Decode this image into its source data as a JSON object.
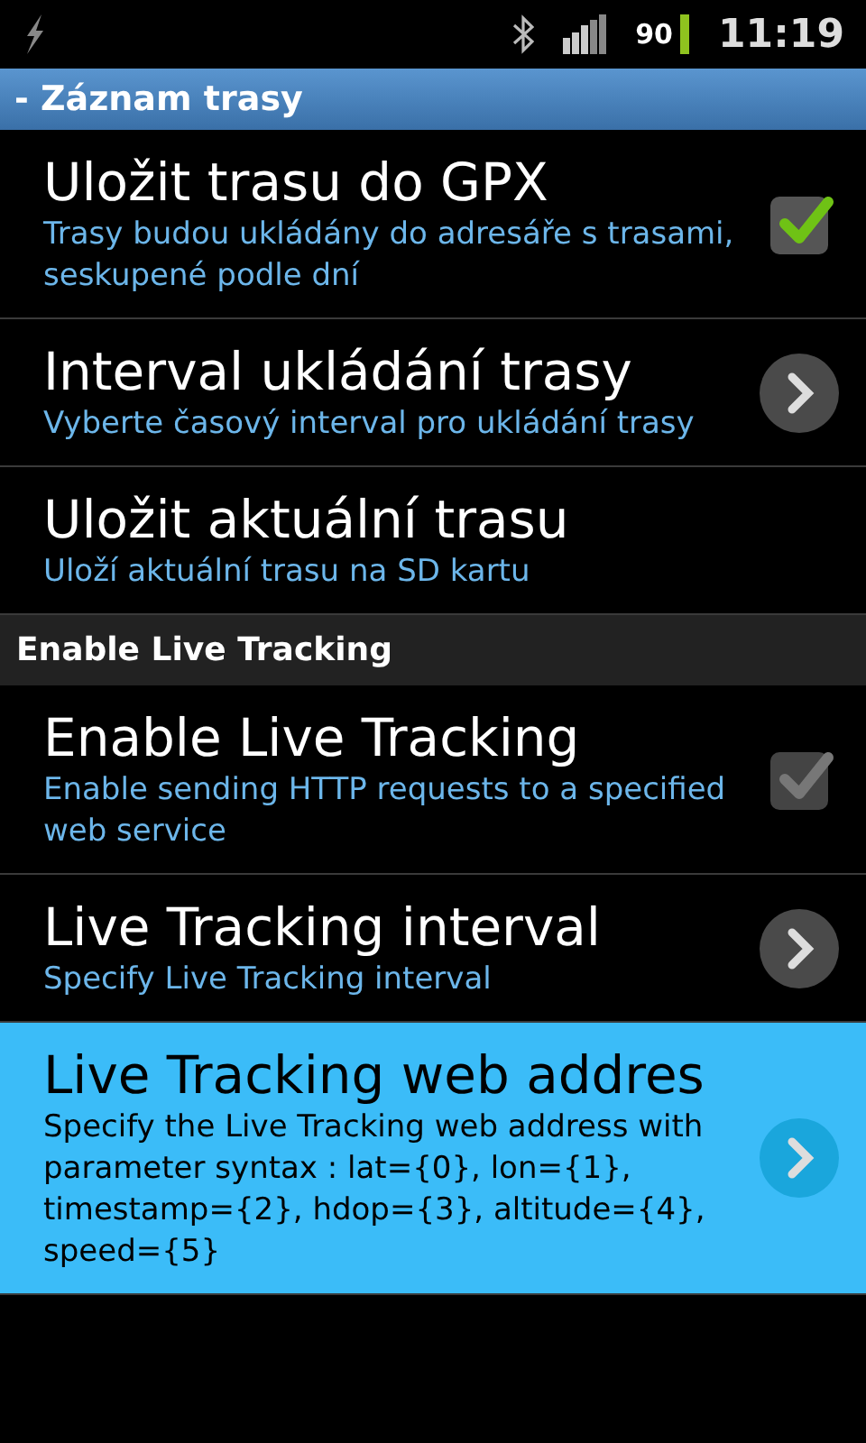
{
  "status_bar": {
    "battery": "90",
    "time": "11:19"
  },
  "title_bar": {
    "title": "- Záznam trasy"
  },
  "items": [
    {
      "kind": "checkbox",
      "title": "Uložit trasu do GPX",
      "summary": "Trasy budou ukládány do adresáře s trasami, seskupené podle dní",
      "checked": true,
      "disabled": false,
      "selected": false
    },
    {
      "kind": "arrow",
      "title": "Interval ukládání trasy",
      "summary": "Vyberte časový interval pro ukládání trasy",
      "selected": false
    },
    {
      "kind": "plain",
      "title": "Uložit aktuální trasu",
      "summary": "Uloží aktuální trasu na SD kartu",
      "selected": false
    },
    {
      "kind": "section",
      "title": "Enable Live Tracking"
    },
    {
      "kind": "checkbox",
      "title": "Enable Live Tracking",
      "summary": "Enable sending HTTP requests to a specified web service",
      "checked": true,
      "disabled": true,
      "selected": false
    },
    {
      "kind": "arrow",
      "title": "Live Tracking interval",
      "summary": "Specify Live Tracking interval",
      "selected": false
    },
    {
      "kind": "arrow",
      "title": "Live Tracking web addres",
      "summary": "Specify the Live Tracking web address with parameter syntax : lat={0}, lon={1}, timestamp={2}, hdop={3}, altitude={4}, speed={5}",
      "selected": true
    }
  ]
}
